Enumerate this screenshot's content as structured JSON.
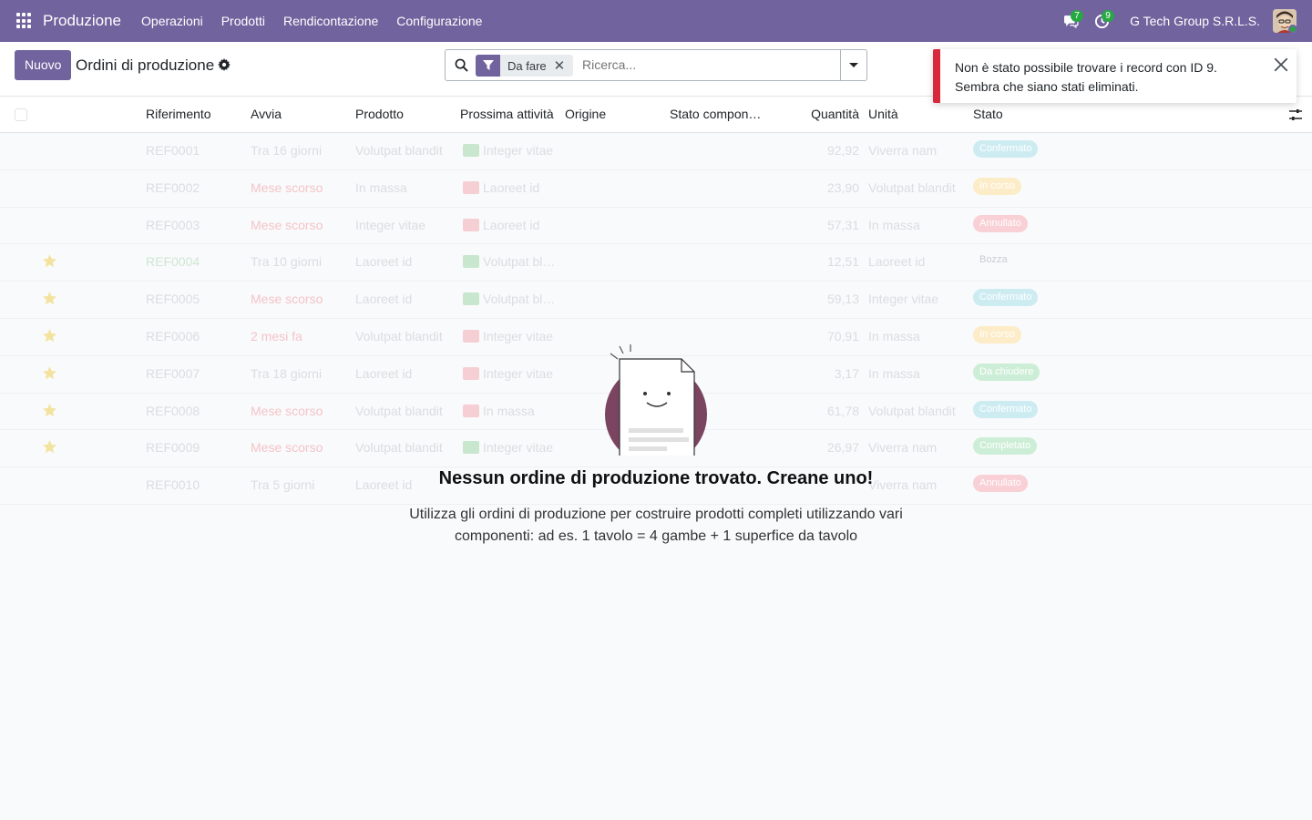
{
  "navbar": {
    "app_name": "Produzione",
    "menu": [
      "Operazioni",
      "Prodotti",
      "Rendicontazione",
      "Configurazione"
    ],
    "messages_count": "7",
    "activities_count": "9",
    "company": "G Tech Group S.R.L.S."
  },
  "control_panel": {
    "new_label": "Nuovo",
    "title": "Ordini di produzione",
    "facet_label": "Da fare",
    "search_placeholder": "Ricerca..."
  },
  "list": {
    "columns": [
      "Riferimento",
      "Avvia",
      "Prodotto",
      "Prossima attività",
      "Origine",
      "Stato compon…",
      "Quantità",
      "Unità",
      "Stato"
    ],
    "rows": [
      {
        "ref": "REF0001",
        "start": "Tra 16 giorni",
        "product": "Volutpat blandit",
        "activity": "Integer vitae",
        "qty": "92,92",
        "unit": "Viverra nam",
        "status": "Confermato",
        "starred": false,
        "late": false,
        "act_color": "green",
        "badge": "blue"
      },
      {
        "ref": "REF0002",
        "start": "Mese scorso",
        "product": "In massa",
        "activity": "Laoreet id",
        "qty": "23,90",
        "unit": "Volutpat blandit",
        "status": "In corso",
        "starred": false,
        "late": true,
        "act_color": "red",
        "badge": "orange"
      },
      {
        "ref": "REF0003",
        "start": "Mese scorso",
        "product": "Integer vitae",
        "activity": "Laoreet id",
        "qty": "57,31",
        "unit": "In massa",
        "status": "Annullato",
        "starred": false,
        "late": true,
        "act_color": "red",
        "badge": "red"
      },
      {
        "ref": "REF0004",
        "start": "Tra 10 giorni",
        "product": "Laoreet id",
        "activity": "Volutpat bl…",
        "qty": "12,51",
        "unit": "Laoreet id",
        "status": "Bozza",
        "starred": true,
        "late": false,
        "act_color": "green",
        "badge": "plain"
      },
      {
        "ref": "REF0005",
        "start": "Mese scorso",
        "product": "Laoreet id",
        "activity": "Volutpat bl…",
        "qty": "59,13",
        "unit": "Integer vitae",
        "status": "Confermato",
        "starred": true,
        "late": true,
        "act_color": "green",
        "badge": "blue"
      },
      {
        "ref": "REF0006",
        "start": "2 mesi fa",
        "product": "Volutpat blandit",
        "activity": "Integer vitae",
        "qty": "70,91",
        "unit": "In massa",
        "status": "In corso",
        "starred": true,
        "late": true,
        "act_color": "red",
        "badge": "orange"
      },
      {
        "ref": "REF0007",
        "start": "Tra 18 giorni",
        "product": "Laoreet id",
        "activity": "Integer vitae",
        "qty": "3,17",
        "unit": "In massa",
        "status": "Da chiudere",
        "starred": true,
        "late": false,
        "act_color": "red",
        "badge": "green"
      },
      {
        "ref": "REF0008",
        "start": "Mese scorso",
        "product": "Volutpat blandit",
        "activity": "In massa",
        "qty": "61,78",
        "unit": "Volutpat blandit",
        "status": "Confermato",
        "starred": true,
        "late": true,
        "act_color": "red",
        "badge": "blue"
      },
      {
        "ref": "REF0009",
        "start": "Mese scorso",
        "product": "Volutpat blandit",
        "activity": "Integer vitae",
        "qty": "26,97",
        "unit": "Viverra nam",
        "status": "Completato",
        "starred": true,
        "late": true,
        "act_color": "green",
        "badge": "green"
      },
      {
        "ref": "REF0010",
        "start": "Tra 5 giorni",
        "product": "Laoreet id",
        "activity": "",
        "qty": "",
        "unit": "Viverra nam",
        "status": "Annullato",
        "starred": false,
        "late": false,
        "act_color": "",
        "badge": "red"
      }
    ]
  },
  "helper": {
    "title": "Nessun ordine di produzione trovato. Creane uno!",
    "text": "Utilizza gli ordini di produzione per costruire prodotti completi utilizzando vari componenti: ad es. 1 tavolo = 4 gambe + 1 superfice da tavolo"
  },
  "notification": {
    "message": "Non è stato possibile trovare i record con ID 9. Sembra che siano stati eliminati."
  },
  "colors": {
    "brand": "#71639e",
    "danger": "#d9273b",
    "success": "#28a745"
  }
}
